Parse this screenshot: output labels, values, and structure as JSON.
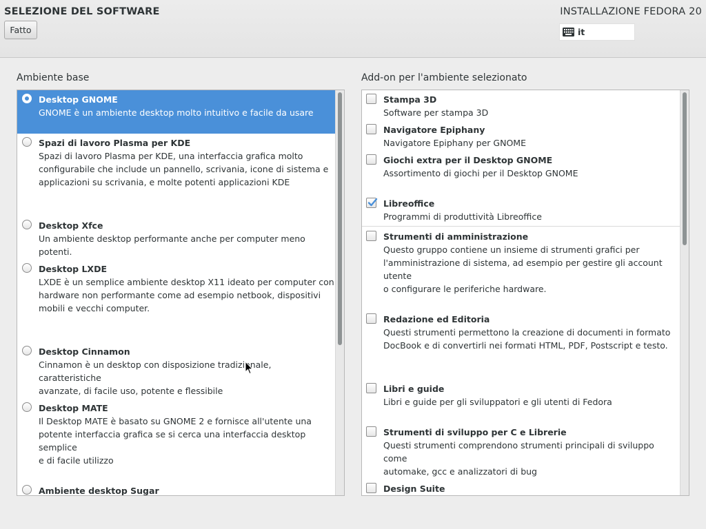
{
  "header": {
    "spoke_title": "SELEZIONE DEL SOFTWARE",
    "done_label": "Fatto",
    "product_title": "INSTALLAZIONE FEDORA 20",
    "keyboard_layout": "it"
  },
  "base_env": {
    "label": "Ambiente base",
    "selected_index": 0,
    "items": [
      {
        "title": "Desktop GNOME",
        "desc": "GNOME è un ambiente desktop molto intuitivo e facile da usare"
      },
      {
        "title": "Spazi di lavoro Plasma per KDE",
        "desc": "Spazi di lavoro Plasma per KDE, una interfaccia grafica molto\nconfigurabile che include un pannello, scrivania, icone di sistema e\napplicazioni su scrivania, e molte potenti applicazioni KDE"
      },
      {
        "title": "Desktop Xfce",
        "desc": "Un ambiente desktop performante anche per computer meno potenti."
      },
      {
        "title": "Desktop LXDE",
        "desc": "LXDE è un semplice ambiente desktop X11 ideato per computer con\nhardware non performante come ad esempio netbook, dispositivi\nmobili e vecchi computer."
      },
      {
        "title": "Desktop Cinnamon",
        "desc": "Cinnamon è un desktop con disposizione tradizionale, caratteristiche\navanzate, di facile uso, potente e flessibile"
      },
      {
        "title": "Desktop MATE",
        "desc": "Il Desktop MATE è basato su GNOME 2 e fornisce all'utente una\npotente interfaccia grafica se si cerca una interfaccia desktop semplice\ne di facile utilizzo"
      },
      {
        "title": "Ambiente desktop Sugar",
        "desc": ""
      }
    ]
  },
  "addons": {
    "label": "Add-on per l'ambiente selezionato",
    "items": [
      {
        "title": "Stampa 3D",
        "desc": "Software per stampa 3D",
        "checked": false
      },
      {
        "title": "Navigatore Epiphany",
        "desc": "Navigatore Epiphany per GNOME",
        "checked": false
      },
      {
        "title": "Giochi extra per il Desktop GNOME",
        "desc": "Assortimento di giochi per il Desktop GNOME",
        "checked": false
      },
      {
        "title": "Libreoffice",
        "desc": "Programmi di produttività Libreoffice",
        "checked": true
      },
      {
        "title": "Strumenti di amministrazione",
        "desc": "Questo gruppo contiene un insieme di strumenti grafici per\nl'amministrazione di sistema, ad esempio per gestire gli account utente\no configurare le periferiche hardware.",
        "checked": false
      },
      {
        "title": "Redazione ed Editoria",
        "desc": "Questi strumenti permettono la creazione di documenti in formato\nDocBook e di convertirli nei formati HTML, PDF, Postscript e testo.",
        "checked": false
      },
      {
        "title": "Libri e guide",
        "desc": "Libri e guide per gli sviluppatori e gli utenti di Fedora",
        "checked": false
      },
      {
        "title": "Strumenti di sviluppo per C e Librerie",
        "desc": "Questi strumenti comprendono strumenti principali di sviluppo come\nautomake, gcc e analizzatori di bug",
        "checked": false
      },
      {
        "title": "Design Suite",
        "desc": "",
        "checked": false
      }
    ]
  },
  "colors": {
    "selection": "#4a90d9",
    "check_mark": "#4a90d9"
  }
}
